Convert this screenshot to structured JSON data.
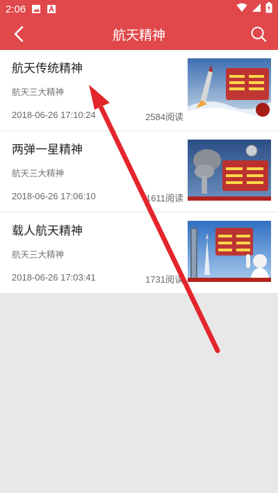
{
  "status": {
    "time": "2:06",
    "icons": [
      "image-icon",
      "font-icon",
      "wifi-icon",
      "signal-icon",
      "battery-icon"
    ]
  },
  "header": {
    "title": "航天精神",
    "back_icon": "chevron-left-icon",
    "search_icon": "search-icon"
  },
  "articles": [
    {
      "title": "航天传统精神",
      "subtitle": "航天三大精神",
      "date": "2018-06-26 17:10:24",
      "reads": "2584阅读"
    },
    {
      "title": "两弹一星精神",
      "subtitle": "航天三大精神",
      "date": "2018-06-26 17:06:10",
      "reads": "1611阅读"
    },
    {
      "title": "载人航天精神",
      "subtitle": "航天三大精神",
      "date": "2018-06-26 17:03:41",
      "reads": "1731阅读"
    }
  ],
  "colors": {
    "header": "#e0484b",
    "arrow": "#e3262b"
  }
}
